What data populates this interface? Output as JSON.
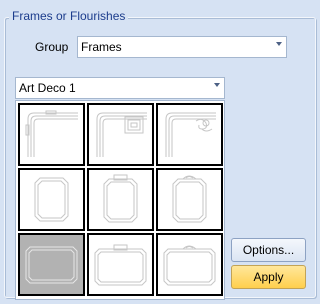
{
  "panel": {
    "legend": "Frames or Flourishes",
    "group_label": "Group",
    "group_value": "Frames",
    "frame_set_value": "Art Deco 1"
  },
  "gallery": {
    "tiles": [
      {
        "id": "corner-plain",
        "selected": false
      },
      {
        "id": "corner-square-ornament",
        "selected": false
      },
      {
        "id": "corner-swirl-ornament",
        "selected": false
      },
      {
        "id": "tall-frame-1",
        "selected": false
      },
      {
        "id": "tall-frame-2",
        "selected": false
      },
      {
        "id": "tall-frame-3",
        "selected": false
      },
      {
        "id": "wide-frame-1",
        "selected": true
      },
      {
        "id": "wide-frame-2",
        "selected": false
      },
      {
        "id": "wide-frame-3",
        "selected": false
      }
    ]
  },
  "buttons": {
    "options": "Options...",
    "apply": "Apply"
  }
}
